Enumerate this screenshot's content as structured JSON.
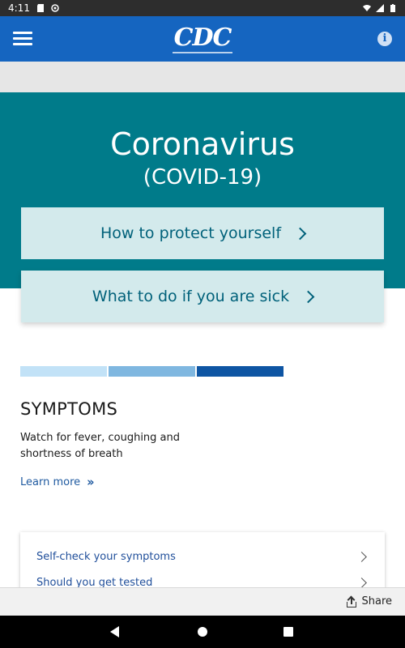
{
  "status_bar": {
    "time": "4:11"
  },
  "app_bar": {
    "logo": "CDC"
  },
  "hero": {
    "title": "Coronavirus",
    "subtitle": "(COVID-19)",
    "buttons": [
      {
        "label": "How to protect yourself"
      },
      {
        "label": "What to do if you are sick"
      }
    ]
  },
  "progress_bars": {
    "colors": [
      "#c2e2f7",
      "#7fb7e0",
      "#0e55a3"
    ]
  },
  "symptoms": {
    "title": "SYMPTOMS",
    "description": "Watch for fever, coughing and shortness of breath",
    "learn_more": "Learn more"
  },
  "links": [
    {
      "label": "Self-check your symptoms"
    },
    {
      "label": "Should you get tested"
    }
  ],
  "bottom_bar": {
    "share_label": "Share"
  },
  "colors": {
    "app_bar": "#1565c0",
    "hero_panel": "#007b8a",
    "hero_button": "#d3eaec",
    "link": "#1f5aa0"
  }
}
